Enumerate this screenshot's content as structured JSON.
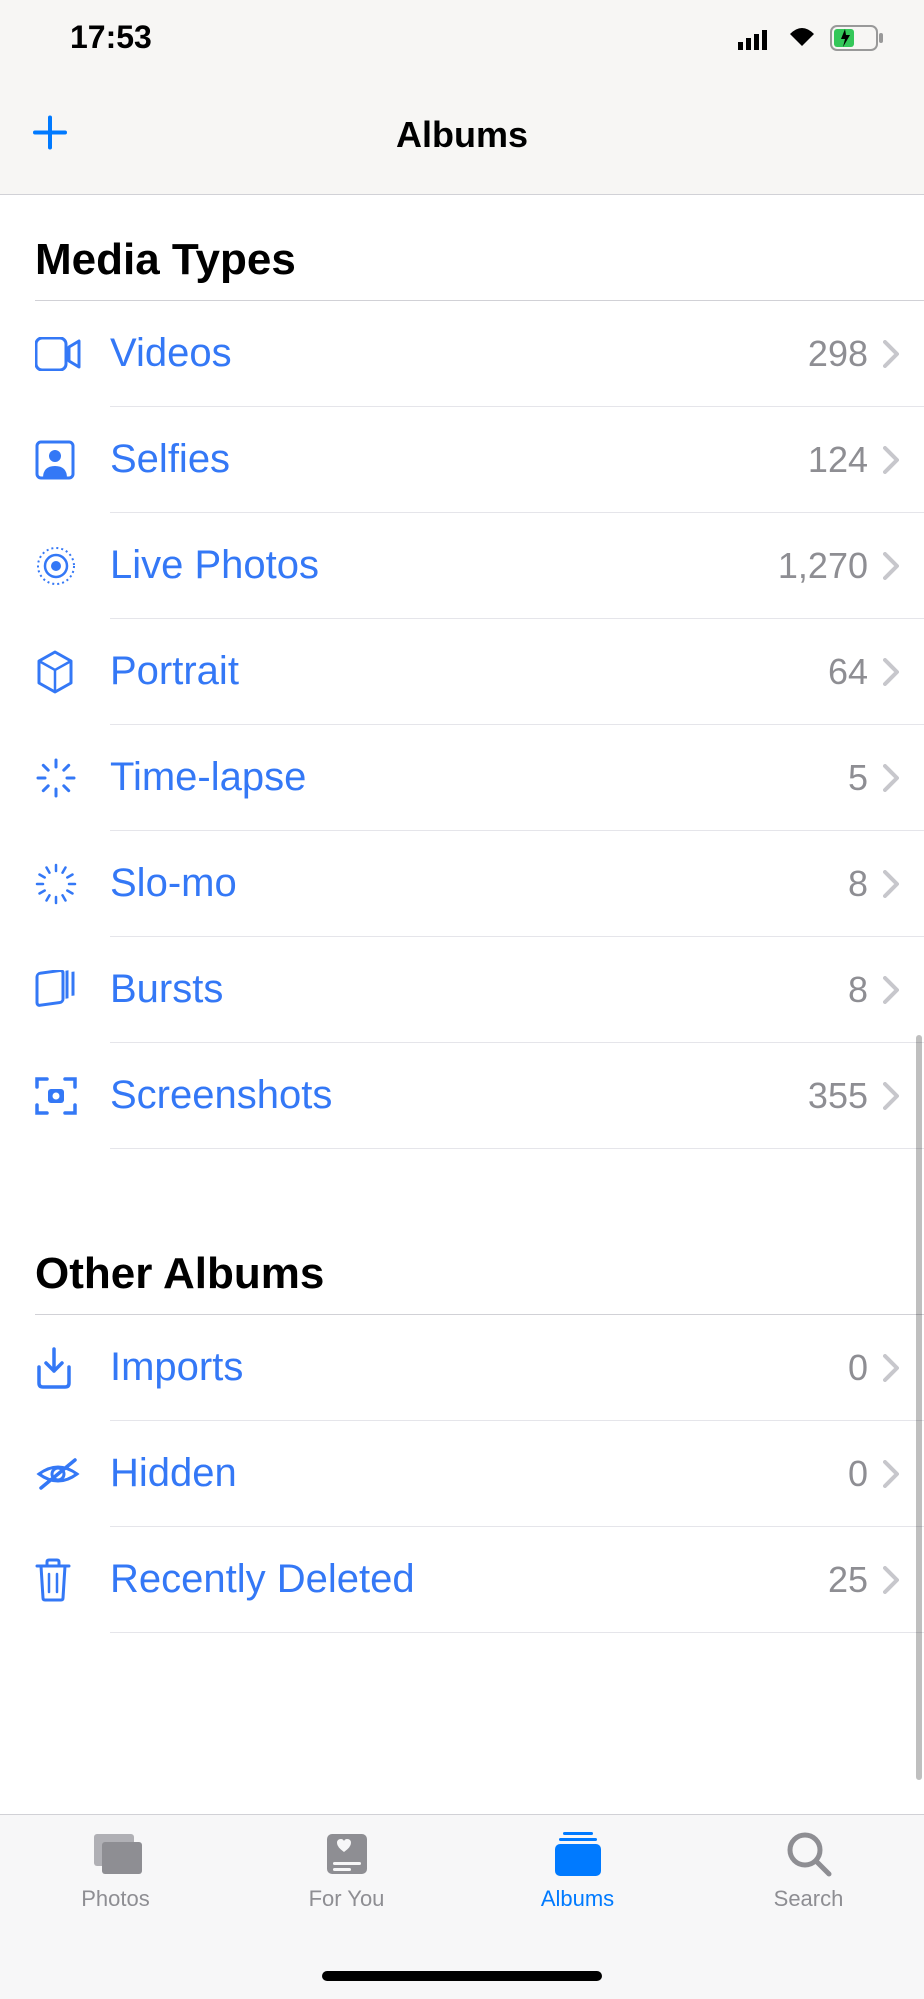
{
  "status": {
    "time": "17:53"
  },
  "nav": {
    "title": "Albums"
  },
  "sections": {
    "mediaTypes": {
      "header": "Media Types",
      "items": [
        {
          "label": "Videos",
          "count": "298"
        },
        {
          "label": "Selfies",
          "count": "124"
        },
        {
          "label": "Live Photos",
          "count": "1,270"
        },
        {
          "label": "Portrait",
          "count": "64"
        },
        {
          "label": "Time-lapse",
          "count": "5"
        },
        {
          "label": "Slo-mo",
          "count": "8"
        },
        {
          "label": "Bursts",
          "count": "8"
        },
        {
          "label": "Screenshots",
          "count": "355"
        }
      ]
    },
    "otherAlbums": {
      "header": "Other Albums",
      "items": [
        {
          "label": "Imports",
          "count": "0"
        },
        {
          "label": "Hidden",
          "count": "0"
        },
        {
          "label": "Recently Deleted",
          "count": "25"
        }
      ]
    }
  },
  "tabs": {
    "photos": "Photos",
    "forYou": "For You",
    "albums": "Albums",
    "search": "Search"
  }
}
